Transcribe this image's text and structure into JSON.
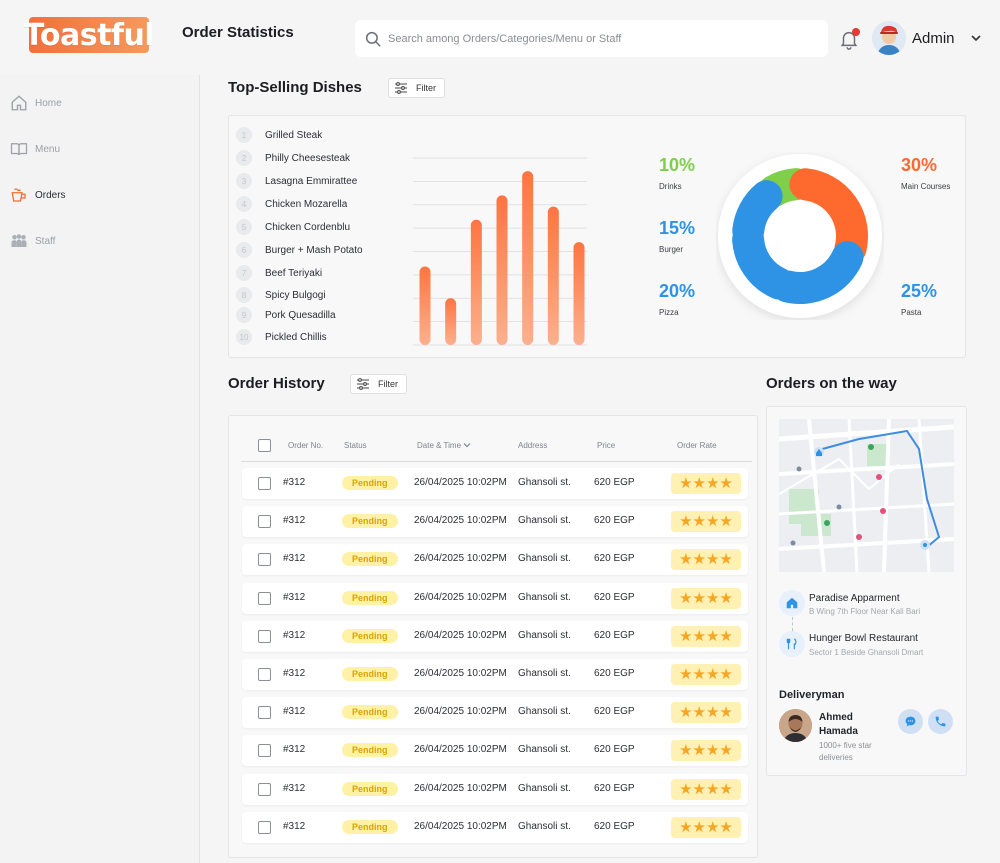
{
  "brand": {
    "logo_text": "Toastful"
  },
  "header": {
    "title": "Order Statistics",
    "search_placeholder": "Search among Orders/Categories/Menu or Staff",
    "user_name": "Admin"
  },
  "sidebar": {
    "items": [
      {
        "label": "Home",
        "icon": "home-icon"
      },
      {
        "label": "Menu",
        "icon": "book-icon"
      },
      {
        "label": "Orders",
        "icon": "orders-icon",
        "active": true
      },
      {
        "label": "Staff",
        "icon": "people-icon"
      }
    ]
  },
  "top_selling": {
    "title": "Top-Selling Dishes",
    "filter_label": "Filter",
    "dishes": [
      {
        "rank": "1",
        "name": "Grilled Steak"
      },
      {
        "rank": "2",
        "name": "Philly Cheesesteak"
      },
      {
        "rank": "3",
        "name": "Lasagna Emmirattee"
      },
      {
        "rank": "4",
        "name": "Chicken Mozarella"
      },
      {
        "rank": "5",
        "name": "Chicken Cordenblu"
      },
      {
        "rank": "6",
        "name": "Burger + Mash Potato"
      },
      {
        "rank": "7",
        "name": "Beef Teriyaki"
      },
      {
        "rank": "8",
        "name": "Spicy Bulgogi"
      },
      {
        "rank": "9",
        "name": "Pork Quesadilla"
      },
      {
        "rank": "10",
        "name": "Pickled Chillis"
      }
    ]
  },
  "chart_data": [
    {
      "type": "bar",
      "values": [
        42,
        25,
        67,
        80,
        93,
        74,
        55
      ],
      "ylim": [
        0,
        100
      ],
      "grid": true,
      "colors": [
        "#fd7540",
        "#fcb08e"
      ]
    },
    {
      "type": "pie",
      "slices": [
        {
          "label": "Drinks",
          "value": 10,
          "percent": "10%",
          "color": "#7fcf4a"
        },
        {
          "label": "Main Courses",
          "value": 30,
          "percent": "30%",
          "color": "#fe6a2e"
        },
        {
          "label": "Pasta",
          "value": 25,
          "percent": "25%",
          "color": "#2e93e5"
        },
        {
          "label": "Pizza",
          "value": 20,
          "percent": "20%",
          "color": "#2e93e5"
        },
        {
          "label": "Burger",
          "value": 15,
          "percent": "15%",
          "color": "#2e93e5"
        }
      ]
    }
  ],
  "order_history": {
    "title": "Order History",
    "filter_label": "Filter",
    "columns": [
      "Order No.",
      "Status",
      "Date & Time",
      "Address",
      "Price",
      "Order Rate"
    ],
    "rows": [
      {
        "order_no": "#312",
        "status": "Pending",
        "datetime": "26/04/2025 10:02PM",
        "address": "Ghansoli st.",
        "price": "620 EGP",
        "rating": "★★★★"
      },
      {
        "order_no": "#312",
        "status": "Pending",
        "datetime": "26/04/2025 10:02PM",
        "address": "Ghansoli st.",
        "price": "620 EGP",
        "rating": "★★★★"
      },
      {
        "order_no": "#312",
        "status": "Pending",
        "datetime": "26/04/2025 10:02PM",
        "address": "Ghansoli st.",
        "price": "620 EGP",
        "rating": "★★★★"
      },
      {
        "order_no": "#312",
        "status": "Pending",
        "datetime": "26/04/2025 10:02PM",
        "address": "Ghansoli st.",
        "price": "620 EGP",
        "rating": "★★★★"
      },
      {
        "order_no": "#312",
        "status": "Pending",
        "datetime": "26/04/2025 10:02PM",
        "address": "Ghansoli st.",
        "price": "620 EGP",
        "rating": "★★★★"
      },
      {
        "order_no": "#312",
        "status": "Pending",
        "datetime": "26/04/2025 10:02PM",
        "address": "Ghansoli st.",
        "price": "620 EGP",
        "rating": "★★★★"
      },
      {
        "order_no": "#312",
        "status": "Pending",
        "datetime": "26/04/2025 10:02PM",
        "address": "Ghansoli st.",
        "price": "620 EGP",
        "rating": "★★★★"
      },
      {
        "order_no": "#312",
        "status": "Pending",
        "datetime": "26/04/2025 10:02PM",
        "address": "Ghansoli st.",
        "price": "620 EGP",
        "rating": "★★★★"
      },
      {
        "order_no": "#312",
        "status": "Pending",
        "datetime": "26/04/2025 10:02PM",
        "address": "Ghansoli st.",
        "price": "620 EGP",
        "rating": "★★★★"
      },
      {
        "order_no": "#312",
        "status": "Pending",
        "datetime": "26/04/2025 10:02PM",
        "address": "Ghansoli st.",
        "price": "620 EGP",
        "rating": "★★★★"
      }
    ]
  },
  "orders_on_way": {
    "title": "Orders on the way",
    "pickup": {
      "title": "Paradise Apparment",
      "subtitle": "B Wing 7th Floor Near Kali Bari"
    },
    "restaurant": {
      "title": "Hunger Bowl Restaurant",
      "subtitle": "Sector 1 Beside Ghansoli Dmart"
    },
    "deliveryman": {
      "heading": "Deliveryman",
      "name": "Ahmed Hamada",
      "subtitle": "1000+ five star deliveries"
    }
  },
  "colors": {
    "accent": "#fd7540",
    "pending_bg": "#fff1a6",
    "pending_text": "#e0a100",
    "star": "#f5a623",
    "blue": "#2e93e5"
  }
}
